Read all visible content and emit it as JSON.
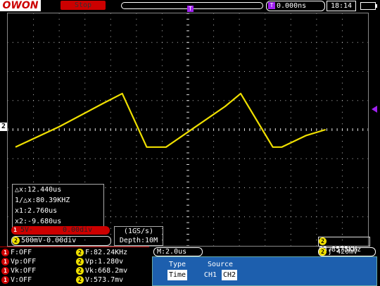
{
  "header": {
    "logo": "OWON",
    "run_status": "Stop",
    "trigger_marker": "T",
    "delay_marker": "T",
    "delay_value": "0.000ns",
    "clock": "18:14"
  },
  "channel_markers": {
    "ch2": "2"
  },
  "cursor_readout": {
    "delta_x": "△x:12.440us",
    "inv_delta_x": "1/△x:80.39KHZ",
    "x1": "x1:2.760us",
    "x2": "x2:-9.680us"
  },
  "ch1_status": {
    "num": "1",
    "scale": "5V-",
    "offset": "0.00div"
  },
  "ch2_status": {
    "num": "2",
    "scale": "500mV-",
    "offset": "0.00div"
  },
  "acquisition": {
    "sample_rate": "(1GS/s)",
    "depth": "Depth:10M"
  },
  "frequency_counter": {
    "num": "2",
    "value": "83.8575KHz"
  },
  "measurements": {
    "ch1": [
      "F:OFF",
      "Vp:OFF",
      "Vk:OFF",
      "V:OFF"
    ],
    "ch2": [
      "F:82.24KHz",
      "Vp:1.280v",
      "Vk:668.2mv",
      "V:573.7mv"
    ],
    "ch1_num": "1",
    "ch2_num": "2"
  },
  "timebase": "M:2.0us",
  "trigger_info": {
    "num": "2",
    "edge": "ƒ",
    "level": "420mV"
  },
  "menu": {
    "type_label": "Type",
    "type_value": "Time",
    "source_label": "Source",
    "source_opt1": "CH1",
    "source_opt2": "CH2"
  },
  "colors": {
    "trace": "#f0e000",
    "grid": "#ffffff",
    "menu": "#1d5fae",
    "ch1": "#cc0000",
    "trigger": "#a020f0"
  },
  "chart_data": {
    "type": "line",
    "xlabel": "",
    "ylabel": "",
    "x_divisions": 14,
    "y_divisions": 8,
    "series": [
      {
        "x": [
          -6.7,
          -5.0,
          -3.3,
          -2.55,
          -1.6,
          -0.85,
          1.45,
          2.05,
          3.3,
          3.65,
          4.6,
          5.35
        ],
        "values": [
          -0.6,
          0.1,
          0.9,
          1.24,
          -0.6,
          -0.6,
          0.8,
          1.24,
          -0.6,
          -0.6,
          -0.2,
          0.0
        ]
      }
    ]
  }
}
